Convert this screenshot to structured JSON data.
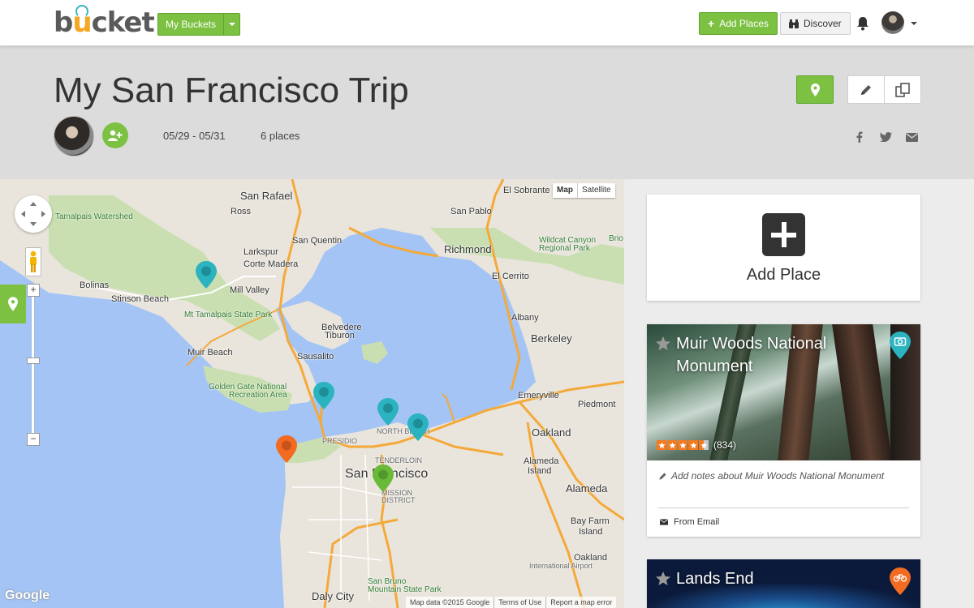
{
  "nav": {
    "logo": "bucket",
    "my_buckets_label": "My Buckets",
    "add_places_label": "Add Places",
    "discover_label": "Discover"
  },
  "trip": {
    "title": "My San Francisco Trip",
    "dates": "05/29 - 05/31",
    "place_count": "6 places"
  },
  "map": {
    "type_options": [
      "Map",
      "Satellite"
    ],
    "selected_type": "Map",
    "attribution": [
      "Map data ©2015 Google",
      "Terms of Use",
      "Report a map error"
    ],
    "provider": "Google",
    "labels": {
      "san_rafael": "San Rafael",
      "ross": "Ross",
      "san_quentin": "San Quentin",
      "san_pablo": "San Pablo",
      "el_sobrante": "El Sobrante",
      "richmond": "Richmond",
      "wildcat": "Wildcat Canyon",
      "wildcat2": "Regional Park",
      "larkspur": "Larkspur",
      "corte_madera": "Corte Madera",
      "tamalpais_watershed": "Tamalpais Watershed",
      "bolinas": "Bolinas",
      "stinson": "Stinson Beach",
      "mill_valley": "Mill Valley",
      "mt_tam": "Mt Tamalpais State Park",
      "el_cerrito": "El Cerrito",
      "albany": "Albany",
      "berkeley": "Berkeley",
      "belvedere": "Belvedere",
      "tiburon": "Tiburon",
      "muir_beach": "Muir Beach",
      "sausalito": "Sausalito",
      "ggnra": "Golden Gate National",
      "ggnra2": "Recreation Area",
      "emeryville": "Emeryville",
      "piedmont": "Piedmont",
      "oakland": "Oakland",
      "north_beach": "NORTH BEACH",
      "presidio": "PRESIDIO",
      "tenderloin": "TENDERLOIN",
      "san_francisco": "San Francisco",
      "mission": "MISSION",
      "mission2": "DISTRICT",
      "alameda_island": "Alameda",
      "alameda_island2": "Island",
      "alameda": "Alameda",
      "bay_farm": "Bay Farm",
      "bay_farm2": "Island",
      "oak_airport": "Oakland",
      "oak_airport2": "International Airport",
      "san_bruno": "San Bruno",
      "san_bruno2": "Mountain State Park",
      "daly_city": "Daly City",
      "brio": "Brio"
    }
  },
  "add_place": {
    "label": "Add Place"
  },
  "places": [
    {
      "name": "Muir Woods National Monument",
      "rating": 4.5,
      "review_count": "(834)",
      "notes_prompt": "Add notes about Muir Woods National Monument",
      "source": "From Email",
      "category_icon": "camera-icon",
      "category_color": "#2bb3c0"
    },
    {
      "name": "Lands End",
      "category_icon": "bike-icon",
      "category_color": "#f26b21"
    }
  ],
  "colors": {
    "brand_green": "#7cc142",
    "pin_teal": "#2bb3c0",
    "pin_orange": "#f26b21",
    "pin_green": "#6aba3a",
    "water": "#a3c4f4"
  }
}
